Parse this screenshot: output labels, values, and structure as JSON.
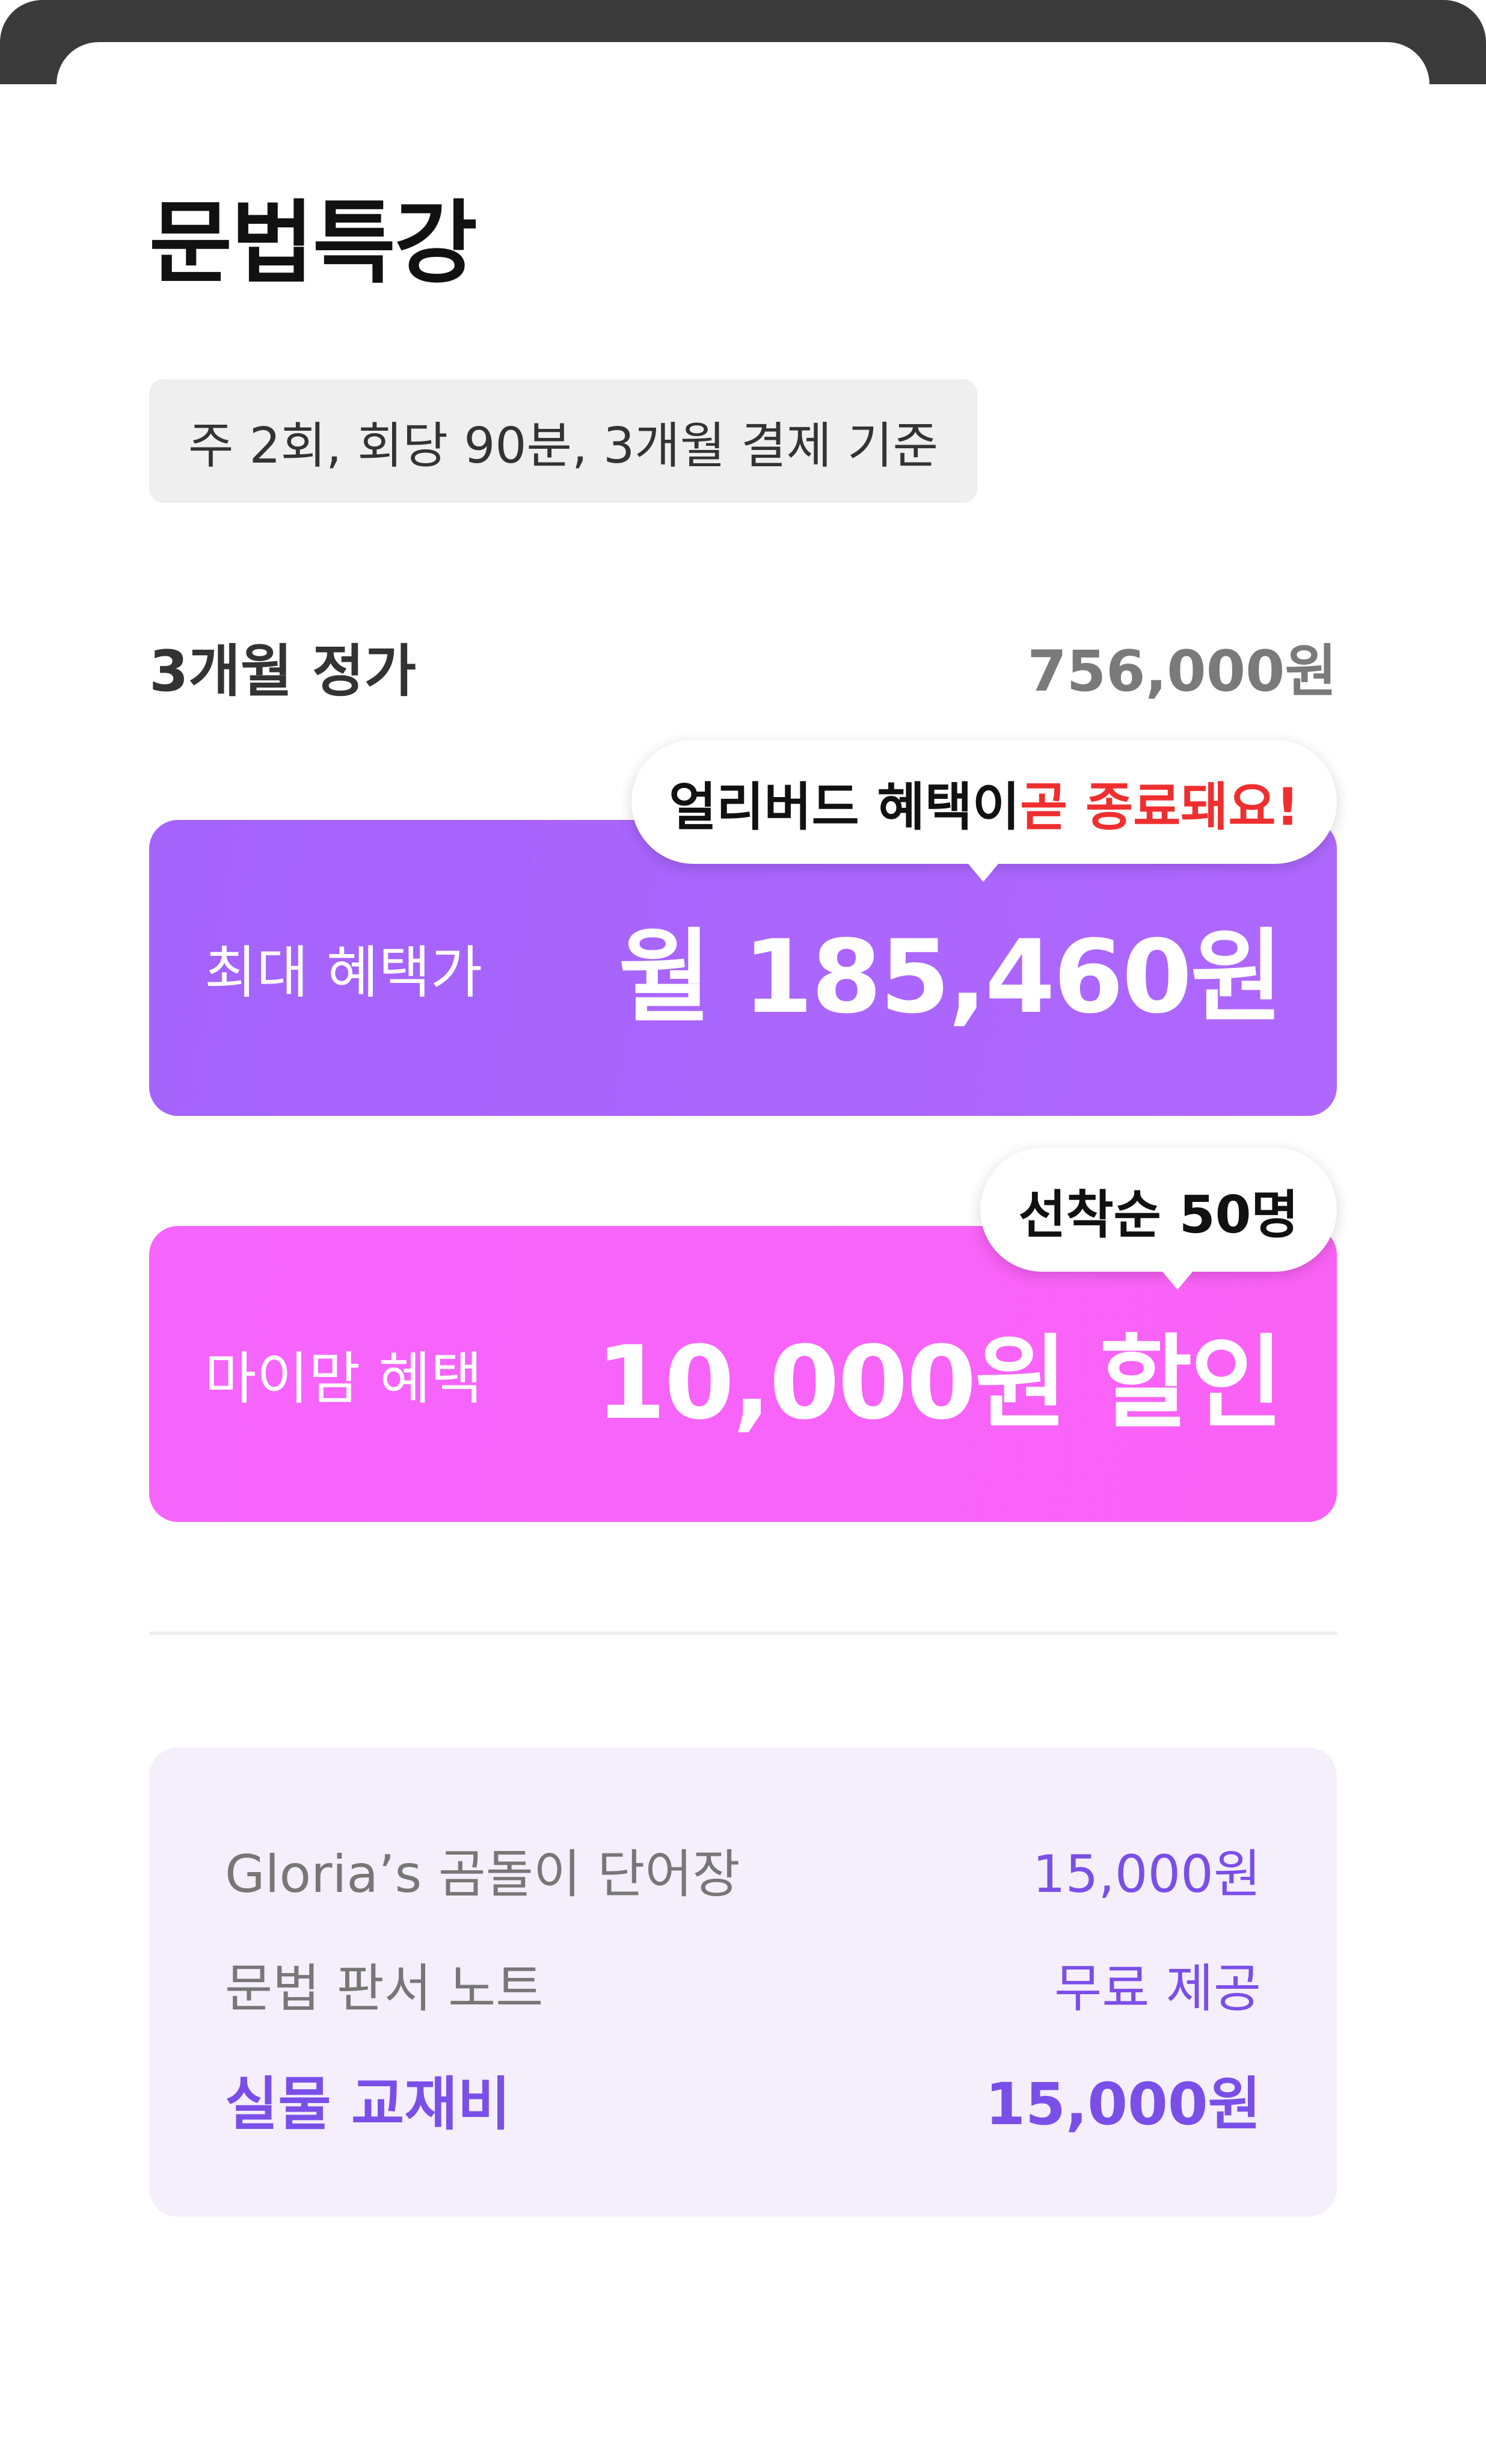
{
  "course": {
    "title": "문법특강",
    "schedule_note": "주 2회, 회당 90분, 3개월 결제 기준"
  },
  "regular_price": {
    "label": "3개월 정가",
    "value": "756,000원"
  },
  "max_benefit": {
    "label": "최대 혜택가",
    "value": "월 185,460원",
    "bubble": {
      "text_main": "얼리버드 혜택이 ",
      "text_highlight": "곧 종료돼요!"
    }
  },
  "mymom_benefit": {
    "label": "마이맘 혜택",
    "value": "10,000원 할인",
    "bubble": {
      "text": "선착순 50명"
    }
  },
  "materials": {
    "items": [
      {
        "label": "Gloria’s 곰돌이 단어장",
        "value": "15,000원"
      },
      {
        "label": "문법 판서 노트",
        "value": "무료 제공"
      }
    ],
    "total": {
      "label": "실물 교재비",
      "value": "15,000원"
    }
  },
  "colors": {
    "max_benefit_bg": "#a864fd",
    "mymom_benefit_bg": "#f763fa",
    "alert_red": "#ef2f2f",
    "accent_purple": "#7a4fe8",
    "materials_bg": "#f4effb"
  }
}
